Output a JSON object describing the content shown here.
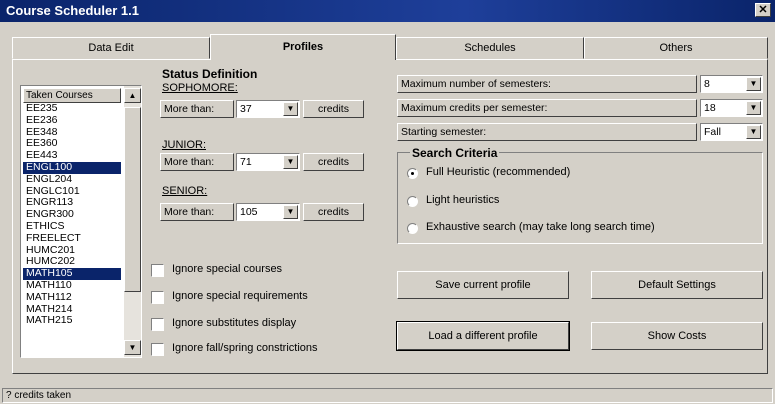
{
  "window": {
    "title": "Course Scheduler 1.1",
    "close_glyph": "✕"
  },
  "tabs": [
    {
      "label": "Data Edit",
      "active": false
    },
    {
      "label": "Profiles",
      "active": true
    },
    {
      "label": "Schedules",
      "active": false
    },
    {
      "label": "Others",
      "active": false
    }
  ],
  "courses": {
    "header": "Taken Courses",
    "items": [
      {
        "label": "EE235",
        "selected": false
      },
      {
        "label": "EE236",
        "selected": false
      },
      {
        "label": "EE348",
        "selected": false
      },
      {
        "label": "EE360",
        "selected": false
      },
      {
        "label": "EE443",
        "selected": false
      },
      {
        "label": "ENGL100",
        "selected": true
      },
      {
        "label": "ENGL204",
        "selected": false
      },
      {
        "label": "ENGLC101",
        "selected": false
      },
      {
        "label": "ENGR113",
        "selected": false
      },
      {
        "label": "ENGR300",
        "selected": false
      },
      {
        "label": "ETHICS",
        "selected": false
      },
      {
        "label": "FREELECT",
        "selected": false
      },
      {
        "label": "HUMC201",
        "selected": false
      },
      {
        "label": "HUMC202",
        "selected": false
      },
      {
        "label": "MATH105",
        "selected": true
      },
      {
        "label": "MATH110",
        "selected": false
      },
      {
        "label": "MATH112",
        "selected": false
      },
      {
        "label": "MATH214",
        "selected": false
      },
      {
        "label": "MATH215",
        "selected": false
      }
    ]
  },
  "status_definition": {
    "title": "Status Definition",
    "more_than": "More than:",
    "credits": "credits",
    "sophomore": {
      "label": "SOPHOMORE:",
      "value": "37"
    },
    "junior": {
      "label": "JUNIOR:",
      "value": "71"
    },
    "senior": {
      "label": "SENIOR:",
      "value": "105"
    }
  },
  "options": [
    {
      "label": "Ignore special courses",
      "checked": false
    },
    {
      "label": "Ignore special requirements",
      "checked": false
    },
    {
      "label": "Ignore substitutes display",
      "checked": false
    },
    {
      "label": "Ignore fall/spring constrictions",
      "checked": false
    }
  ],
  "settings": {
    "max_semesters": {
      "label": "Maximum number of semesters:",
      "value": "8"
    },
    "max_credits": {
      "label": "Maximum credits per semester:",
      "value": "18"
    },
    "starting": {
      "label": "Starting semester:",
      "value": "Fall"
    }
  },
  "search": {
    "title": "Search Criteria",
    "options": [
      {
        "label": "Full Heuristic (recommended)",
        "selected": true
      },
      {
        "label": "Light heuristics",
        "selected": false
      },
      {
        "label": "Exhaustive search (may take long search time)",
        "selected": false
      }
    ]
  },
  "buttons": {
    "save_profile": "Save current profile",
    "default_settings": "Default Settings",
    "load_profile": "Load a different profile",
    "show_costs": "Show Costs"
  },
  "statusbar": {
    "text": "? credits taken"
  }
}
